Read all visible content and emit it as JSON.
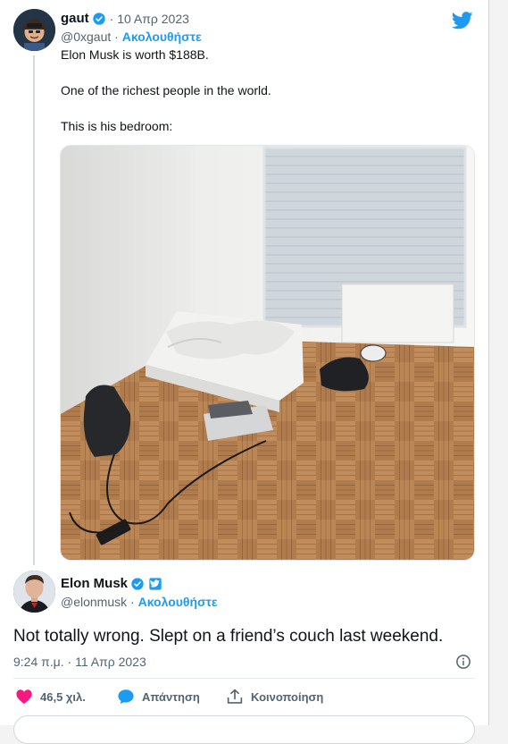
{
  "colors": {
    "link": "#1d9bf0",
    "muted": "#536471",
    "like": "#f91880"
  },
  "tweet1": {
    "name": "gaut",
    "date": "· 10 Απρ 2023",
    "handle": "@0xgaut",
    "dot": "·",
    "follow": "Ακολουθήστε",
    "lines": [
      "Elon Musk is worth $188B.",
      "One of the richest people in the world.",
      "This is his bedroom:"
    ],
    "media": "bedroom-photo"
  },
  "tweet2": {
    "name": "Elon Musk",
    "handle": "@elonmusk",
    "dot": "·",
    "follow": "Ακολουθήστε",
    "text": "Not totally wrong. Slept on a friend’s couch last weekend.",
    "timestamp": "9:24 π.μ. · 11 Απρ 2023"
  },
  "actions": {
    "likes": "46,5 χιλ.",
    "reply": "Απάντηση",
    "share": "Κοινοποίηση"
  },
  "icons": [
    "verified-badge-icon",
    "twitter-bird-icon",
    "info-icon",
    "heart-icon",
    "reply-bubble-icon",
    "share-icon"
  ]
}
